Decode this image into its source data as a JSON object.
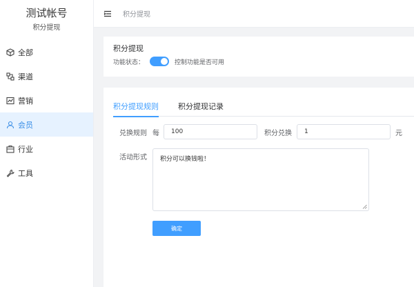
{
  "brand": {
    "title": "测试帐号",
    "subtitle": "积分提现"
  },
  "sidebar": {
    "items": [
      {
        "label": "全部",
        "icon": "cube-icon"
      },
      {
        "label": "渠道",
        "icon": "channel-icon"
      },
      {
        "label": "营销",
        "icon": "chart-icon"
      },
      {
        "label": "会员",
        "icon": "user-icon",
        "active": true
      },
      {
        "label": "行业",
        "icon": "briefcase-icon"
      },
      {
        "label": "工具",
        "icon": "wrench-icon"
      }
    ]
  },
  "topbar": {
    "breadcrumb": "积分提现"
  },
  "status_card": {
    "title": "积分提现",
    "status_label": "功能状态：",
    "switch_on": true,
    "hint": "控制功能是否可用"
  },
  "tabs": [
    {
      "label": "积分提现规则",
      "active": true
    },
    {
      "label": "积分提现记录",
      "active": false
    }
  ],
  "form": {
    "rule_label": "兑换规则",
    "per_label": "每",
    "points_value": "100",
    "exchange_label": "积分兑换",
    "amount_value": "1",
    "unit_label": "元",
    "activity_label": "活动形式",
    "activity_text": "积分可以换钱啦！",
    "submit_label": "确定"
  },
  "colors": {
    "accent": "#409eff",
    "active_menu_bg": "#e6f2ff"
  }
}
